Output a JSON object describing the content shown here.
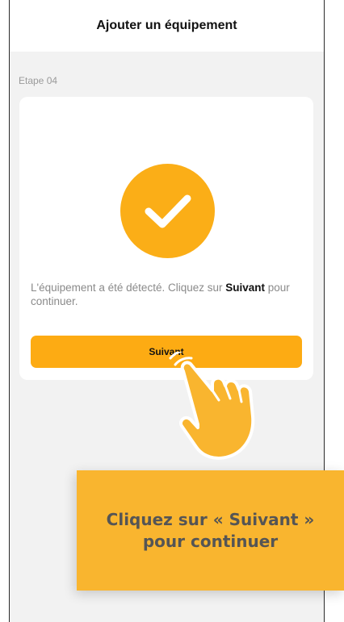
{
  "header": {
    "title": "Ajouter un équipement"
  },
  "step": {
    "label": "Etape 04"
  },
  "card": {
    "message_before": "L'équipement a été détecté. Cliquez sur ",
    "message_highlight": "Suivant",
    "message_after": " pour continuer.",
    "icon": "check-circle-icon",
    "next_button_label": "Suivant"
  },
  "overlay": {
    "hand_icon": "pointing-hand-icon",
    "callout_line1": "Cliquez sur « Suivant »",
    "callout_line2": "pour continuer"
  },
  "colors": {
    "accent": "#fbae17",
    "callout": "#f9b52f",
    "background": "#f2f2f2"
  }
}
